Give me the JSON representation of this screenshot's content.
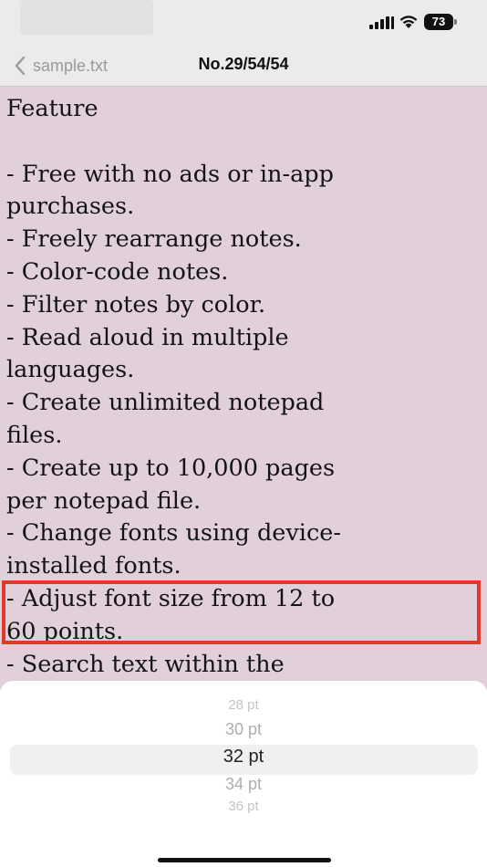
{
  "status_bar": {
    "battery_level": "73"
  },
  "nav": {
    "back_label": "sample.txt",
    "title": "No.29/54/54"
  },
  "note": {
    "lines": [
      "Feature",
      "",
      "- Free with no ads or in-app",
      "purchases.",
      "- Freely rearrange notes.",
      "- Color-code notes.",
      "- Filter notes by color.",
      "- Read aloud in multiple",
      "languages.",
      "- Create unlimited notepad",
      "files.",
      "- Create up to 10,000 pages",
      "per notepad file.",
      "- Change fonts using device-",
      "installed fonts.",
      "- Adjust font size from 12 to",
      "60 points.",
      "- Search text within the"
    ]
  },
  "picker": {
    "options": [
      "28 pt",
      "30 pt",
      "32 pt",
      "34 pt",
      "36 pt"
    ],
    "selected": "32 pt"
  },
  "colors": {
    "note_background": "#e1cfda",
    "highlight_border": "#e0392b"
  }
}
